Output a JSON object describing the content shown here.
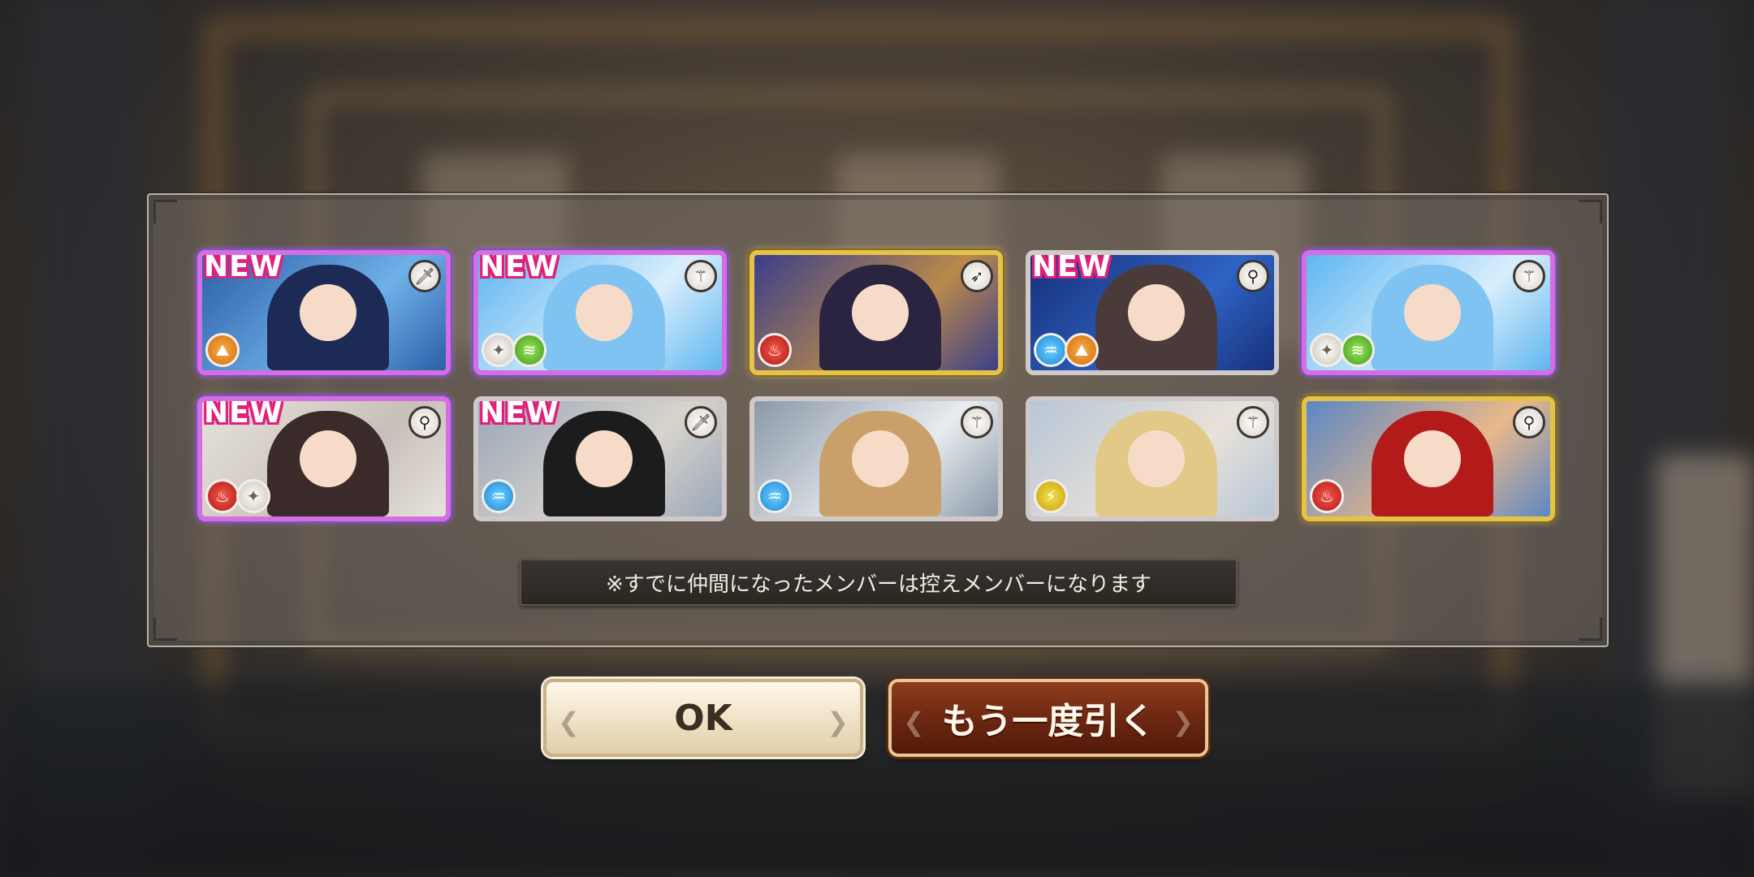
{
  "results": [
    {
      "new": true,
      "rarity": "rare",
      "weapon": "sword",
      "elements": [
        "earth"
      ]
    },
    {
      "new": true,
      "rarity": "rare",
      "weapon": "staff",
      "elements": [
        "light",
        "wind"
      ]
    },
    {
      "new": false,
      "rarity": "gold",
      "weapon": "bow",
      "elements": [
        "fire"
      ]
    },
    {
      "new": true,
      "rarity": "normal",
      "weapon": "magnifier",
      "elements": [
        "water",
        "earth"
      ]
    },
    {
      "new": false,
      "rarity": "rare",
      "weapon": "staff",
      "elements": [
        "light",
        "wind"
      ]
    },
    {
      "new": true,
      "rarity": "rare",
      "weapon": "magnifier",
      "elements": [
        "fire",
        "light"
      ]
    },
    {
      "new": true,
      "rarity": "normal",
      "weapon": "sword",
      "elements": [
        "water"
      ]
    },
    {
      "new": false,
      "rarity": "normal",
      "weapon": "staff",
      "elements": [
        "water"
      ]
    },
    {
      "new": false,
      "rarity": "normal",
      "weapon": "staff",
      "elements": [
        "thunder"
      ]
    },
    {
      "new": false,
      "rarity": "gold",
      "weapon": "magnifier",
      "elements": [
        "fire"
      ]
    }
  ],
  "new_label": "NEW",
  "notice": "※すでに仲間になったメンバーは控えメンバーになります",
  "buttons": {
    "ok": "OK",
    "draw_again": "もう一度引く"
  },
  "colors": {
    "rare_frame": "#d46fe0",
    "gold_frame": "#e4c34a",
    "normal_frame": "#cfc9c9",
    "new_badge": "#e0207a"
  }
}
